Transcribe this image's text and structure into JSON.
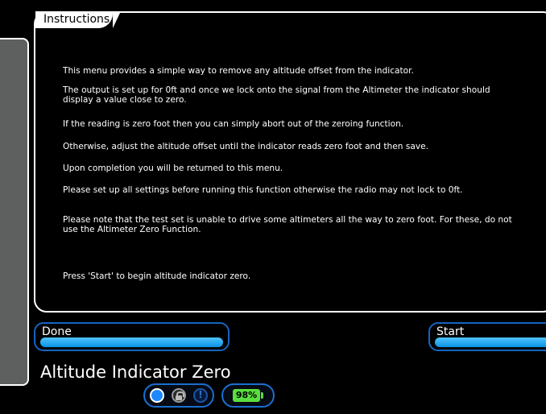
{
  "panel": {
    "tab_label": "Instructions",
    "lines": [
      "This menu provides a simple way to remove any altitude offset from the indicator.",
      "The output is set up for 0ft and once we lock onto the signal from the Altimeter the indicator should display a value close to zero.",
      "If the reading is zero foot then you can simply abort out of the zeroing function.",
      "Otherwise, adjust the altitude offset until the indicator reads zero foot and then save.",
      "Upon completion you will be returned to this menu.",
      "Please set up all settings before running this function otherwise the radio may not lock to 0ft.",
      "Please note that the test set is unable to drive some altimeters all the way to zero foot. For these, do not use the Altimeter Zero Function.",
      "Press 'Start' to begin altitude indicator zero."
    ]
  },
  "buttons": {
    "done": "Done",
    "start": "Start"
  },
  "screen_title": "Altitude Indicator Zero",
  "status": {
    "icons": [
      "circle-status-icon",
      "lock-icon",
      "alert-icon"
    ],
    "alert_glyph": "!",
    "battery_percent": "98%"
  },
  "colors": {
    "accent": "#0a93e3",
    "battery": "#5adf3e"
  }
}
